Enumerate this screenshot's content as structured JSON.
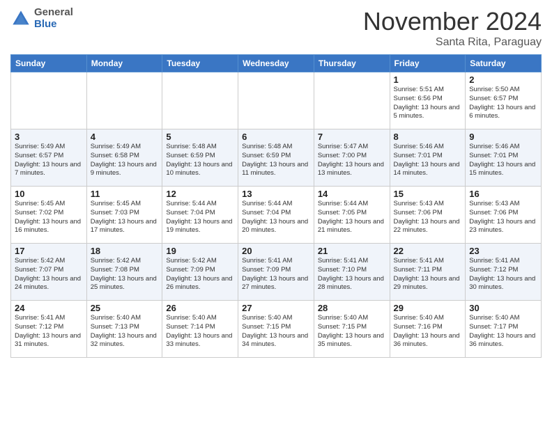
{
  "logo": {
    "general": "General",
    "blue": "Blue"
  },
  "header": {
    "month": "November 2024",
    "location": "Santa Rita, Paraguay"
  },
  "days_of_week": [
    "Sunday",
    "Monday",
    "Tuesday",
    "Wednesday",
    "Thursday",
    "Friday",
    "Saturday"
  ],
  "weeks": [
    [
      {
        "day": "",
        "info": ""
      },
      {
        "day": "",
        "info": ""
      },
      {
        "day": "",
        "info": ""
      },
      {
        "day": "",
        "info": ""
      },
      {
        "day": "",
        "info": ""
      },
      {
        "day": "1",
        "info": "Sunrise: 5:51 AM\nSunset: 6:56 PM\nDaylight: 13 hours and 5 minutes."
      },
      {
        "day": "2",
        "info": "Sunrise: 5:50 AM\nSunset: 6:57 PM\nDaylight: 13 hours and 6 minutes."
      }
    ],
    [
      {
        "day": "3",
        "info": "Sunrise: 5:49 AM\nSunset: 6:57 PM\nDaylight: 13 hours and 7 minutes."
      },
      {
        "day": "4",
        "info": "Sunrise: 5:49 AM\nSunset: 6:58 PM\nDaylight: 13 hours and 9 minutes."
      },
      {
        "day": "5",
        "info": "Sunrise: 5:48 AM\nSunset: 6:59 PM\nDaylight: 13 hours and 10 minutes."
      },
      {
        "day": "6",
        "info": "Sunrise: 5:48 AM\nSunset: 6:59 PM\nDaylight: 13 hours and 11 minutes."
      },
      {
        "day": "7",
        "info": "Sunrise: 5:47 AM\nSunset: 7:00 PM\nDaylight: 13 hours and 13 minutes."
      },
      {
        "day": "8",
        "info": "Sunrise: 5:46 AM\nSunset: 7:01 PM\nDaylight: 13 hours and 14 minutes."
      },
      {
        "day": "9",
        "info": "Sunrise: 5:46 AM\nSunset: 7:01 PM\nDaylight: 13 hours and 15 minutes."
      }
    ],
    [
      {
        "day": "10",
        "info": "Sunrise: 5:45 AM\nSunset: 7:02 PM\nDaylight: 13 hours and 16 minutes."
      },
      {
        "day": "11",
        "info": "Sunrise: 5:45 AM\nSunset: 7:03 PM\nDaylight: 13 hours and 17 minutes."
      },
      {
        "day": "12",
        "info": "Sunrise: 5:44 AM\nSunset: 7:04 PM\nDaylight: 13 hours and 19 minutes."
      },
      {
        "day": "13",
        "info": "Sunrise: 5:44 AM\nSunset: 7:04 PM\nDaylight: 13 hours and 20 minutes."
      },
      {
        "day": "14",
        "info": "Sunrise: 5:44 AM\nSunset: 7:05 PM\nDaylight: 13 hours and 21 minutes."
      },
      {
        "day": "15",
        "info": "Sunrise: 5:43 AM\nSunset: 7:06 PM\nDaylight: 13 hours and 22 minutes."
      },
      {
        "day": "16",
        "info": "Sunrise: 5:43 AM\nSunset: 7:06 PM\nDaylight: 13 hours and 23 minutes."
      }
    ],
    [
      {
        "day": "17",
        "info": "Sunrise: 5:42 AM\nSunset: 7:07 PM\nDaylight: 13 hours and 24 minutes."
      },
      {
        "day": "18",
        "info": "Sunrise: 5:42 AM\nSunset: 7:08 PM\nDaylight: 13 hours and 25 minutes."
      },
      {
        "day": "19",
        "info": "Sunrise: 5:42 AM\nSunset: 7:09 PM\nDaylight: 13 hours and 26 minutes."
      },
      {
        "day": "20",
        "info": "Sunrise: 5:41 AM\nSunset: 7:09 PM\nDaylight: 13 hours and 27 minutes."
      },
      {
        "day": "21",
        "info": "Sunrise: 5:41 AM\nSunset: 7:10 PM\nDaylight: 13 hours and 28 minutes."
      },
      {
        "day": "22",
        "info": "Sunrise: 5:41 AM\nSunset: 7:11 PM\nDaylight: 13 hours and 29 minutes."
      },
      {
        "day": "23",
        "info": "Sunrise: 5:41 AM\nSunset: 7:12 PM\nDaylight: 13 hours and 30 minutes."
      }
    ],
    [
      {
        "day": "24",
        "info": "Sunrise: 5:41 AM\nSunset: 7:12 PM\nDaylight: 13 hours and 31 minutes."
      },
      {
        "day": "25",
        "info": "Sunrise: 5:40 AM\nSunset: 7:13 PM\nDaylight: 13 hours and 32 minutes."
      },
      {
        "day": "26",
        "info": "Sunrise: 5:40 AM\nSunset: 7:14 PM\nDaylight: 13 hours and 33 minutes."
      },
      {
        "day": "27",
        "info": "Sunrise: 5:40 AM\nSunset: 7:15 PM\nDaylight: 13 hours and 34 minutes."
      },
      {
        "day": "28",
        "info": "Sunrise: 5:40 AM\nSunset: 7:15 PM\nDaylight: 13 hours and 35 minutes."
      },
      {
        "day": "29",
        "info": "Sunrise: 5:40 AM\nSunset: 7:16 PM\nDaylight: 13 hours and 36 minutes."
      },
      {
        "day": "30",
        "info": "Sunrise: 5:40 AM\nSunset: 7:17 PM\nDaylight: 13 hours and 36 minutes."
      }
    ]
  ]
}
